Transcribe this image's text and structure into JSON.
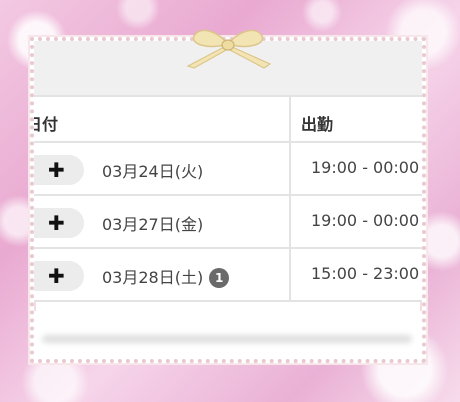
{
  "table": {
    "headers": {
      "date": "日付",
      "shift": "出勤"
    },
    "rows": [
      {
        "date": "03月24日(火)",
        "shift": "19:00 - 00:00",
        "badge": ""
      },
      {
        "date": "03月27日(金)",
        "shift": "19:00 - 00:00",
        "badge": ""
      },
      {
        "date": "03月28日(土)",
        "shift": "15:00 - 23:00",
        "badge": "1"
      }
    ]
  },
  "icons": {
    "expand": "plus-icon",
    "decoration": "ribbon-bow-icon"
  },
  "colors": {
    "badge": "#6a6a6a",
    "frame": "#e8c9cf",
    "background": "#eab1d5"
  }
}
